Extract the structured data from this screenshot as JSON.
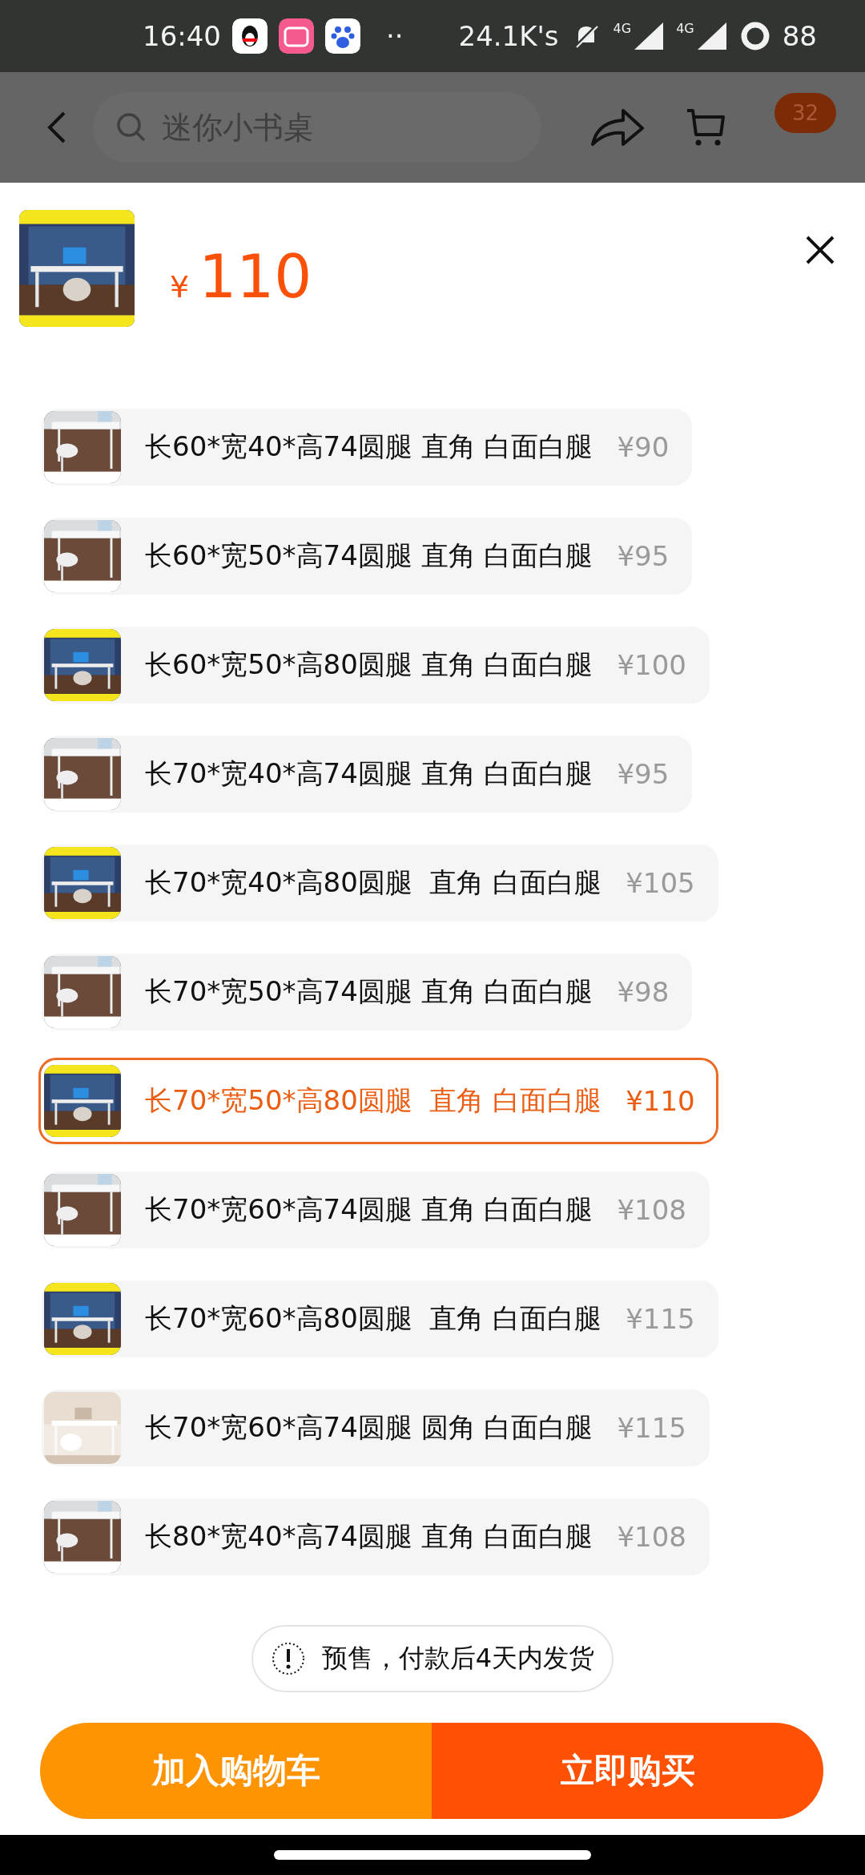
{
  "status_bar": {
    "time": "16:40",
    "dots": "··",
    "network_speed": "24.1K's",
    "signal_labels": [
      "4G",
      "4G"
    ],
    "battery": "88"
  },
  "header": {
    "search": {
      "placeholder": "迷你小书桌"
    },
    "cart_badge": "32"
  },
  "product": {
    "currency": "¥",
    "price": "110"
  },
  "variants": [
    {
      "label": "长60*宽40*高74圆腿 直角 白面白腿",
      "price": "¥90",
      "selected": false
    },
    {
      "label": "长60*宽50*高74圆腿 直角 白面白腿",
      "price": "¥95",
      "selected": false
    },
    {
      "label": "长60*宽50*高80圆腿 直角 白面白腿",
      "price": "¥100",
      "selected": false
    },
    {
      "label": "长70*宽40*高74圆腿 直角 白面白腿",
      "price": "¥95",
      "selected": false
    },
    {
      "label": "长70*宽40*高80圆腿  直角 白面白腿",
      "price": "¥105",
      "selected": false
    },
    {
      "label": "长70*宽50*高74圆腿 直角 白面白腿",
      "price": "¥98",
      "selected": false
    },
    {
      "label": "长70*宽50*高80圆腿  直角 白面白腿",
      "price": "¥110",
      "selected": true
    },
    {
      "label": "长70*宽60*高74圆腿 直角 白面白腿",
      "price": "¥108",
      "selected": false
    },
    {
      "label": "长70*宽60*高80圆腿  直角 白面白腿",
      "price": "¥115",
      "selected": false
    },
    {
      "label": "长70*宽60*高74圆腿 圆角 白面白腿",
      "price": "¥115",
      "selected": false
    },
    {
      "label": "长80*宽40*高74圆腿 直角 白面白腿",
      "price": "¥108",
      "selected": false
    }
  ],
  "notice": "预售，付款后4天内发货",
  "buttons": [
    {
      "label": "加入购物车",
      "kind": "cart"
    },
    {
      "label": "立即购买",
      "kind": "buy"
    }
  ]
}
